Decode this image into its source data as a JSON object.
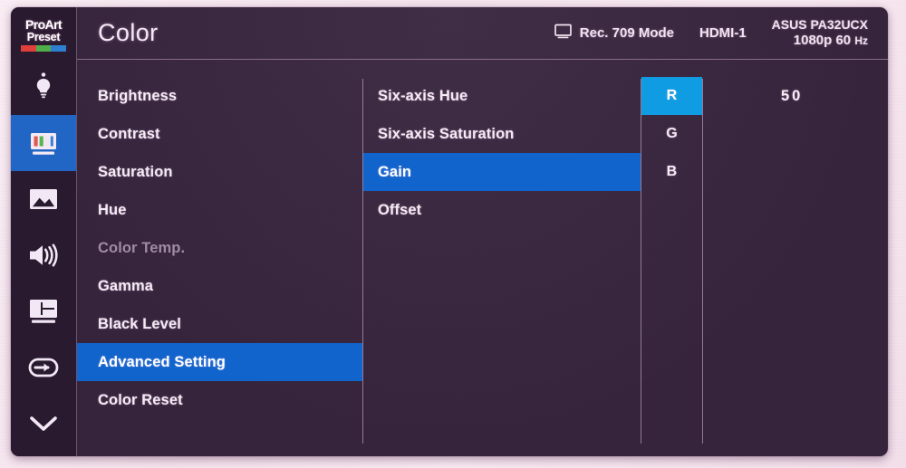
{
  "brand": {
    "logo_line1": "ProArt",
    "logo_line2": "Preset",
    "bar_red": "#e0403c",
    "bar_green": "#4fae4a",
    "bar_blue": "#2f7fd0"
  },
  "colors": {
    "panel_bg": "#33213a",
    "sidebar_bg": "#2a1a30",
    "highlight_blue": "#1164cc",
    "highlight_cyan": "#0f9ce2",
    "sidebar_active": "#2166c4",
    "text": "#f4ecf5",
    "text_disabled": "#a08ba6",
    "divider": "#cdafcd"
  },
  "header": {
    "title": "Color",
    "monitor_icon": "monitor-icon",
    "mode": "Rec. 709 Mode",
    "input": "HDMI-1",
    "model": "ASUS PA32UCX",
    "resolution": "1080p 60",
    "refresh_unit": "Hz"
  },
  "sidebar": {
    "items": [
      {
        "icon": "lightbulb-icon",
        "name": "proart-palette",
        "active": false
      },
      {
        "icon": "color-monitor-icon",
        "name": "color",
        "active": true
      },
      {
        "icon": "image-icon",
        "name": "image",
        "active": false
      },
      {
        "icon": "speaker-icon",
        "name": "sound",
        "active": false
      },
      {
        "icon": "pip-pbp-icon",
        "name": "pip-pbp",
        "active": false
      },
      {
        "icon": "input-select-icon",
        "name": "input-select",
        "active": false
      },
      {
        "icon": "chevron-down-icon",
        "name": "more",
        "active": false
      }
    ]
  },
  "menu": {
    "column1": [
      {
        "label": "Brightness",
        "state": "normal"
      },
      {
        "label": "Contrast",
        "state": "normal"
      },
      {
        "label": "Saturation",
        "state": "normal"
      },
      {
        "label": "Hue",
        "state": "normal"
      },
      {
        "label": "Color Temp.",
        "state": "disabled"
      },
      {
        "label": "Gamma",
        "state": "normal"
      },
      {
        "label": "Black Level",
        "state": "normal"
      },
      {
        "label": "Advanced Setting",
        "state": "selected"
      },
      {
        "label": "Color Reset",
        "state": "normal"
      }
    ],
    "column2": [
      {
        "label": "Six-axis Hue",
        "state": "normal"
      },
      {
        "label": "Six-axis Saturation",
        "state": "normal"
      },
      {
        "label": "Gain",
        "state": "selected"
      },
      {
        "label": "Offset",
        "state": "normal"
      }
    ],
    "column3": [
      {
        "label": "R",
        "state": "selected",
        "value": "50"
      },
      {
        "label": "G",
        "state": "normal",
        "value": ""
      },
      {
        "label": "B",
        "state": "normal",
        "value": ""
      }
    ]
  }
}
